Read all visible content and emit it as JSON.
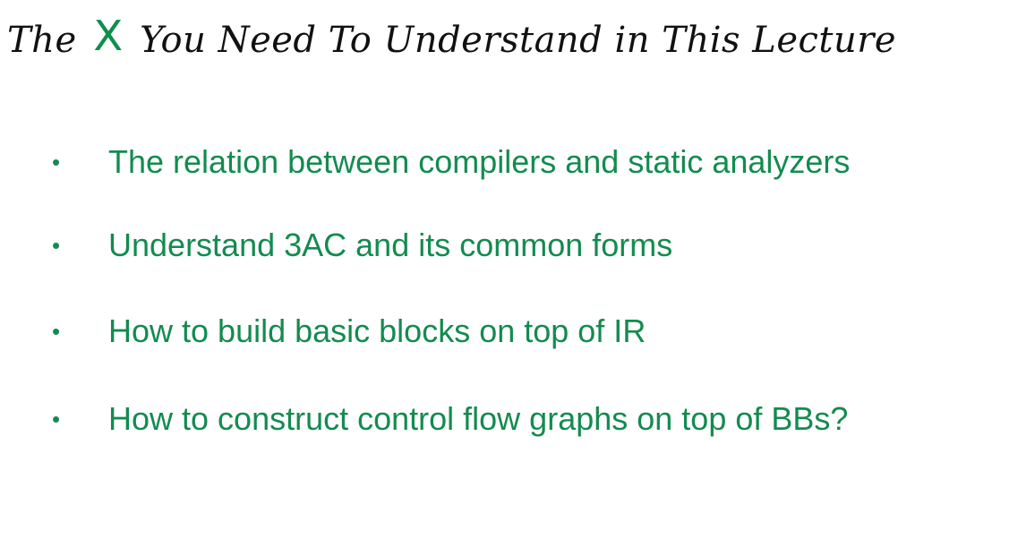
{
  "slide": {
    "title": {
      "prefix": "The",
      "mark": "X",
      "suffix": "You Need To Understand in This Lecture"
    },
    "bullets": [
      {
        "marker": "•",
        "text": "The relation between compilers and static analyzers"
      },
      {
        "marker": "•",
        "text": "Understand 3AC and its common forms"
      },
      {
        "marker": "•",
        "text": "How to build basic blocks on top of IR"
      },
      {
        "marker": "•",
        "text": "How to construct control flow graphs on top of BBs?"
      }
    ]
  },
  "colors": {
    "title_text": "#111111",
    "accent_green": "#0e8f4b",
    "bullet_green": "#138b4f",
    "background": "#ffffff"
  }
}
